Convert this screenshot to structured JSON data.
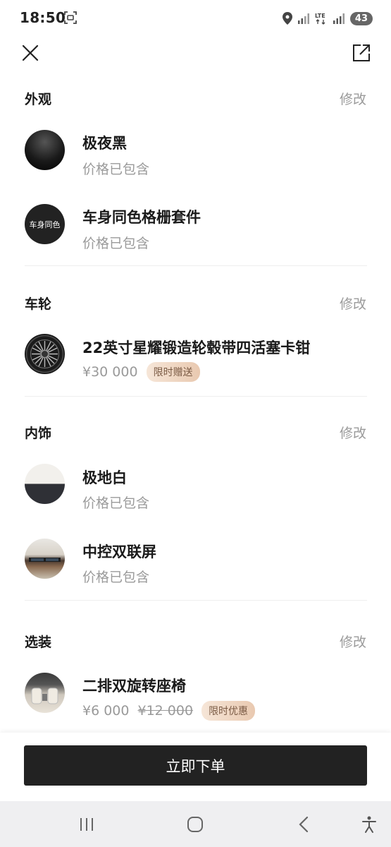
{
  "status_bar": {
    "time": "18:50",
    "battery": "43"
  },
  "sections": [
    {
      "title": "外观",
      "edit": "修改",
      "items": [
        {
          "name": "极夜黑",
          "sub": "价格已包含"
        },
        {
          "name": "车身同色格栅套件",
          "sub": "价格已包含",
          "thumb_text": "车身同色"
        }
      ]
    },
    {
      "title": "车轮",
      "edit": "修改",
      "items": [
        {
          "name": "22英寸星耀锻造轮毂带四活塞卡钳",
          "price": "¥30 000",
          "tag": "限时赠送"
        }
      ]
    },
    {
      "title": "内饰",
      "edit": "修改",
      "items": [
        {
          "name": "极地白",
          "sub": "价格已包含"
        },
        {
          "name": "中控双联屏",
          "sub": "价格已包含"
        }
      ]
    },
    {
      "title": "选装",
      "edit": "修改",
      "items": [
        {
          "name": "二排双旋转座椅",
          "price": "¥6 000",
          "original_price": "¥12 000",
          "tag": "限时优惠"
        }
      ]
    }
  ],
  "order_button": "立即下单",
  "colors": {
    "accent": "#222222",
    "muted": "#9a9a9a",
    "tag_bg": "#f0d8c4"
  }
}
